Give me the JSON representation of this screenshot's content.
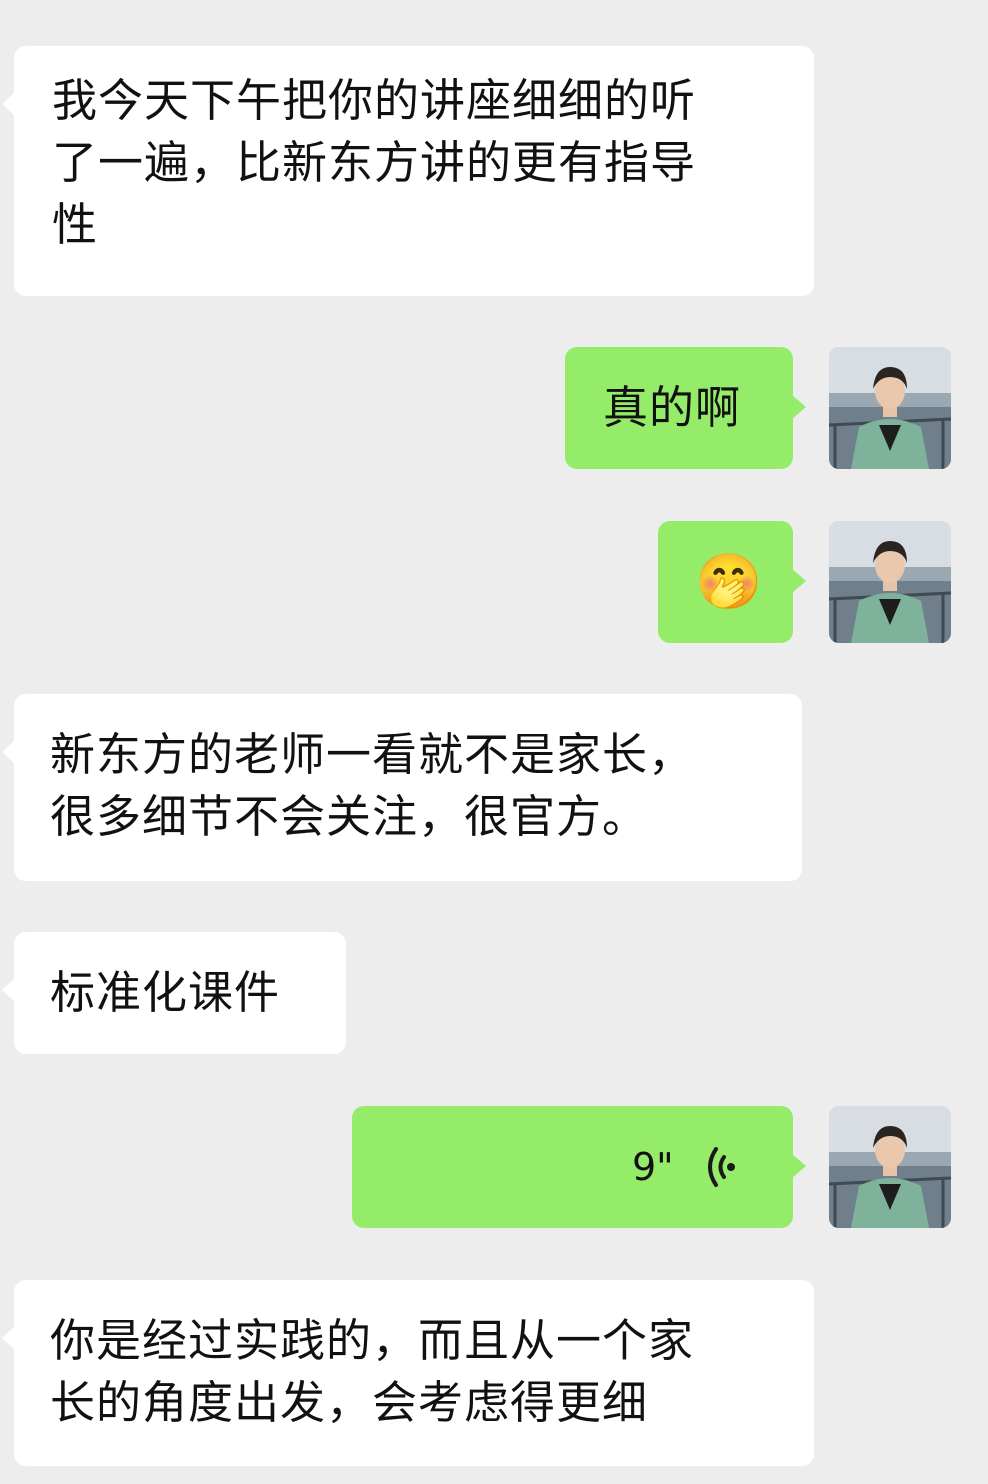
{
  "chat": {
    "messages": [
      {
        "side": "in",
        "type": "text",
        "lines": [
          "我今天下午把你的讲座细细的听",
          "了一遍，比新东方讲的更有指导",
          "性"
        ]
      },
      {
        "side": "out",
        "type": "text",
        "text": "真的啊"
      },
      {
        "side": "out",
        "type": "emoji",
        "emoji": "🤭",
        "emoji_icon": "hand-over-mouth-emoji-icon"
      },
      {
        "side": "in",
        "type": "text",
        "lines": [
          "新东方的老师一看就不是家长，",
          "很多细节不会关注，很官方。"
        ]
      },
      {
        "side": "in",
        "type": "text",
        "text": "标准化课件"
      },
      {
        "side": "out",
        "type": "voice",
        "duration": "9\"",
        "voice_icon": "voice-wave-icon"
      },
      {
        "side": "in",
        "type": "text",
        "lines": [
          "你是经过实践的，而且从一个家",
          "长的角度出发，会考虑得更细"
        ]
      }
    ]
  },
  "colors": {
    "background": "#ededed",
    "incoming_bubble": "#ffffff",
    "outgoing_bubble": "#95ec69",
    "text": "#111111"
  }
}
